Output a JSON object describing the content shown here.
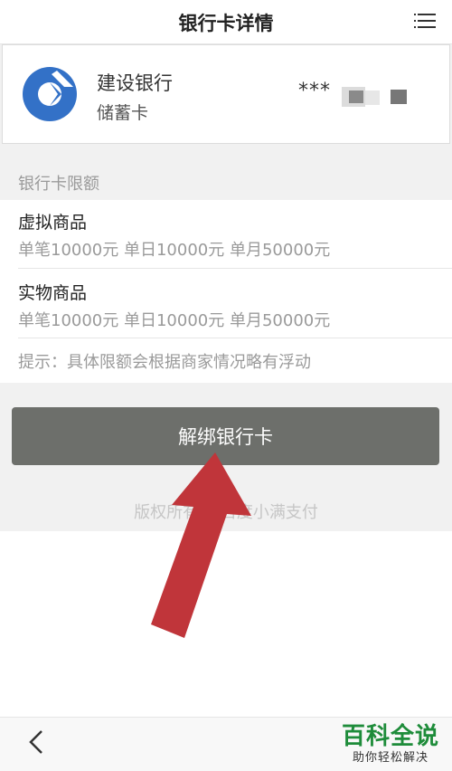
{
  "header": {
    "title": "银行卡详情",
    "menu_icon": "list-menu-icon"
  },
  "card": {
    "bank_name": "建设银行",
    "card_type": "储蓄卡",
    "masked_number": "***",
    "logo_icon": "ccb-bank-logo-icon",
    "logo_color": "#3371c7"
  },
  "limits": {
    "section_label": "银行卡限额",
    "items": [
      {
        "title": "虚拟商品",
        "detail": "单笔10000元 单日10000元 单月50000元"
      },
      {
        "title": "实物商品",
        "detail": "单笔10000元 单日10000元 单月50000元"
      }
    ],
    "tip": "提示：具体限额会根据商家情况略有浮动"
  },
  "actions": {
    "unbind_label": "解绑银行卡",
    "button_color": "#6d6f6b"
  },
  "copyright": "版权所有 ©百度小满支付",
  "annotation": {
    "arrow_color": "#c0353a"
  },
  "footer": {
    "back_icon": "chevron-left-icon",
    "watermark_title": "百科全说",
    "watermark_subtitle": "助你轻松解决",
    "watermark_color": "#1e8c3a"
  }
}
